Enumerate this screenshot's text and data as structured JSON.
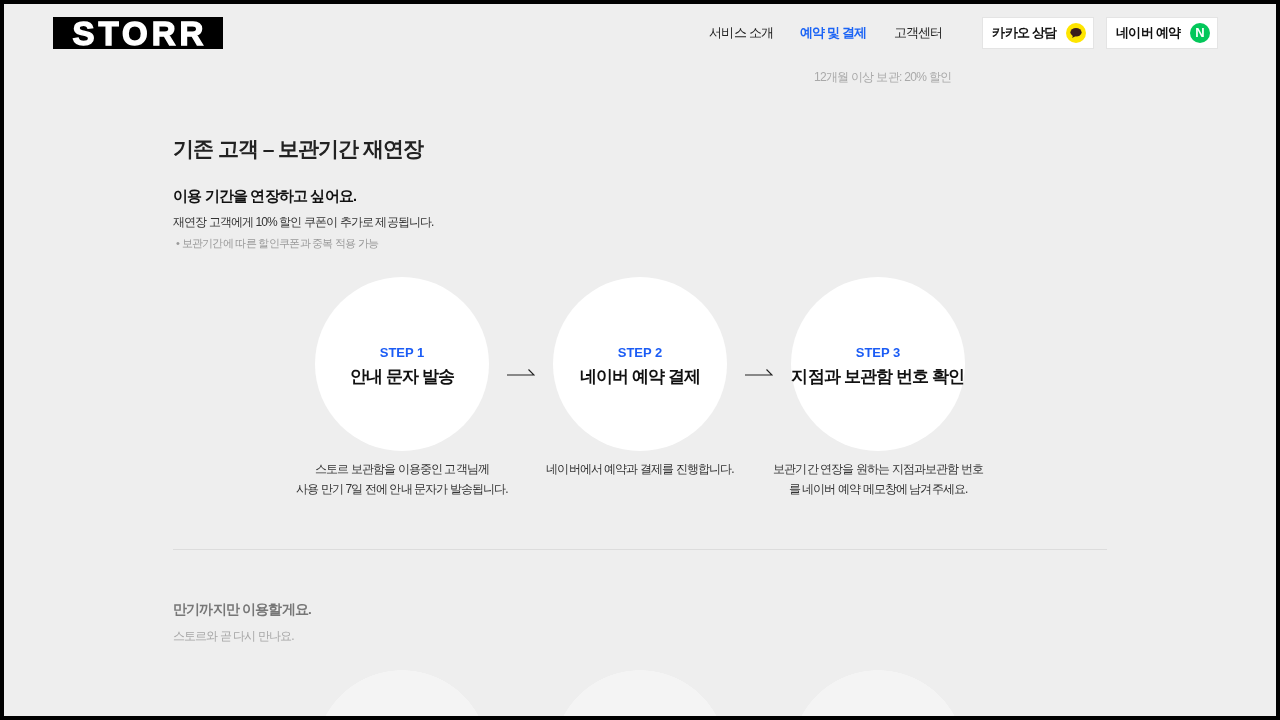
{
  "header": {
    "logo": "STORR",
    "nav": [
      {
        "label": "서비스 소개",
        "selected": false
      },
      {
        "label": "예약 및 결제",
        "selected": true
      },
      {
        "label": "고객센터",
        "selected": false
      }
    ],
    "buttons": [
      {
        "label": "카카오 상담",
        "kind": "chat"
      },
      {
        "label": "네이버 예약",
        "kind": "letter",
        "icon_text": "N"
      }
    ]
  },
  "promo": "12개월 이상 보관: 20% 할인",
  "title": "기존 고객 – 보관기간 재연장",
  "sections": [
    {
      "dimmed": false,
      "heading": "이용 기간을 연장하고 싶어요.",
      "description": "재연장 고객에게 10% 할인 쿠폰이 추가로 제공됩니다.",
      "note": "• 보관기간에 따른 할인쿠폰과 중복 적용 가능",
      "steps": [
        {
          "label": "STEP 1",
          "title": "안내 문자 발송",
          "description": [
            "스토르 보관함을 이용중인 고객님께",
            "사용 만기 7일 전에 안내 문자가 발송됩니다."
          ]
        },
        {
          "label": "STEP 2",
          "title": "네이버 예약 결제",
          "description": [
            "네이버에서 예약과 결제를 진행합니다."
          ]
        },
        {
          "label": "STEP 3",
          "title": "지점과 보관함 번호 확인",
          "description": [
            "보관기간 연장을 원하는 지점과보관함 번호",
            "를 네이버 예약 메모창에 남겨주세요."
          ]
        }
      ]
    },
    {
      "dimmed": true,
      "heading": "만기까지만 이용할게요.",
      "description": "스토르와 곧 다시 만나요."
    }
  ]
}
